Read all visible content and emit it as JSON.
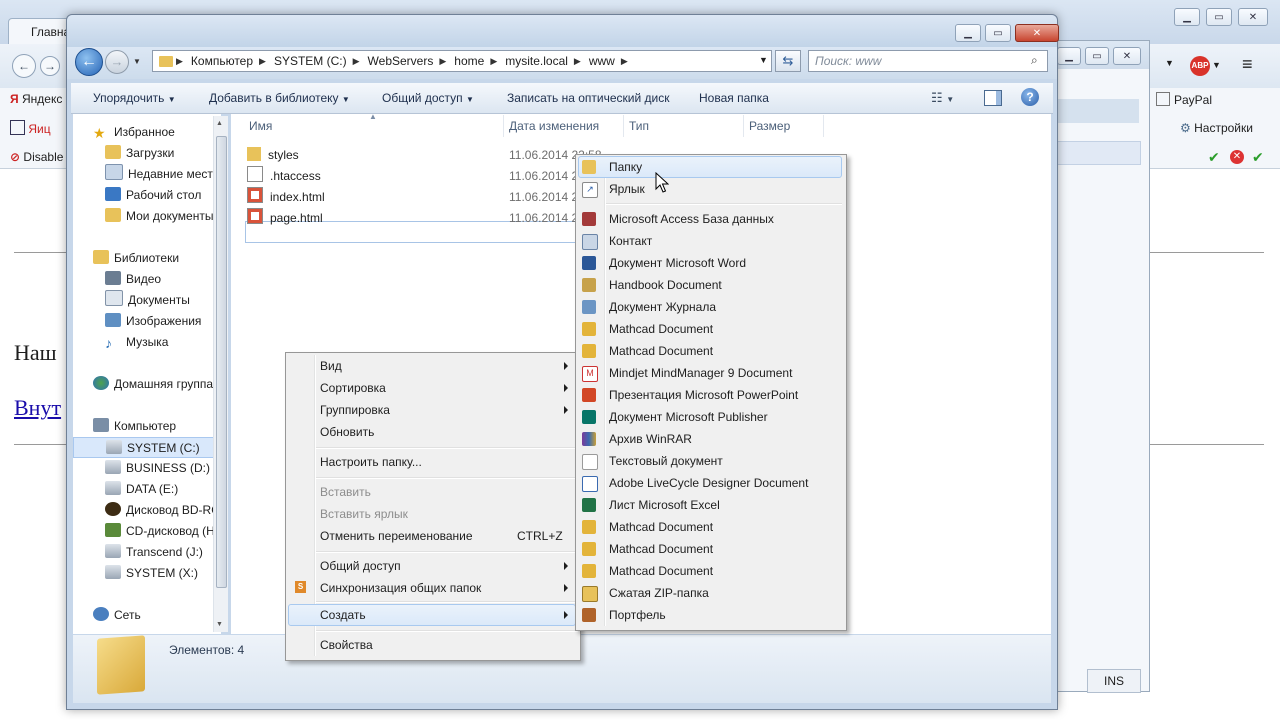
{
  "browser": {
    "tab_label": "Главна",
    "bookmarks": [
      "Яндекс",
      "Яиц",
      "Disable"
    ],
    "right_items": [
      "PayPal",
      "Настройки"
    ],
    "content_heading": "Наш",
    "content_link": "Внут",
    "status_right": "INS"
  },
  "explorer": {
    "address": [
      "Компьютер",
      "SYSTEM (C:)",
      "WebServers",
      "home",
      "mysite.local",
      "www"
    ],
    "search_placeholder": "Поиск: www",
    "commands": [
      "Упорядочить",
      "Добавить в библиотеку",
      "Общий доступ",
      "Записать на оптический диск",
      "Новая папка"
    ],
    "nav": {
      "favorites": "Избранное",
      "favorites_items": [
        "Загрузки",
        "Недавние места",
        "Рабочий стол",
        "Мои документы"
      ],
      "libraries": "Библиотеки",
      "libraries_items": [
        "Видео",
        "Документы",
        "Изображения",
        "Музыка"
      ],
      "homegroup": "Домашняя группа",
      "computer": "Компьютер",
      "computer_items": [
        "SYSTEM (C:)",
        "BUSINESS (D:)",
        "DATA (E:)",
        "Дисковод BD-RO",
        "CD-дисковод (H",
        "Transcend (J:)",
        "SYSTEM (X:)"
      ],
      "network": "Сеть"
    },
    "columns": [
      "Имя",
      "Дата изменения",
      "Тип",
      "Размер"
    ],
    "files": [
      {
        "name": "styles",
        "date": "11.06.2014 22:58"
      },
      {
        "name": ".htaccess",
        "date": "11.06.2014 22:58"
      },
      {
        "name": "index.html",
        "date": "11.06.2014 22:58"
      },
      {
        "name": "page.html",
        "date": "11.06.2014 22:58"
      }
    ],
    "status": "Элементов: 4"
  },
  "context_menu": {
    "view": "Вид",
    "sort": "Сортировка",
    "group": "Группировка",
    "refresh": "Обновить",
    "customize": "Настроить папку...",
    "paste": "Вставить",
    "paste_shortcut": "Вставить ярлык",
    "undo": "Отменить переименование",
    "undo_key": "CTRL+Z",
    "share": "Общий доступ",
    "sync": "Синхронизация общих папок",
    "create": "Создать",
    "properties": "Свойства"
  },
  "submenu": {
    "items": [
      "Папку",
      "Ярлык",
      "Microsoft Access База данных",
      "Контакт",
      "Документ Microsoft Word",
      "Handbook Document",
      "Документ Журнала",
      "Mathcad Document",
      "Mathcad Document",
      "Mindjet MindManager 9 Document",
      "Презентация Microsoft PowerPoint",
      "Документ Microsoft Publisher",
      "Архив WinRAR",
      "Текстовый документ",
      "Adobe LiveCycle Designer Document",
      "Лист Microsoft Excel",
      "Mathcad Document",
      "Mathcad Document",
      "Mathcad Document",
      "Сжатая ZIP-папка",
      "Портфель"
    ]
  },
  "colors": {
    "accent": "#3399ff",
    "menu_bg": "#f0f0f0",
    "folder": "#e8c25a"
  }
}
